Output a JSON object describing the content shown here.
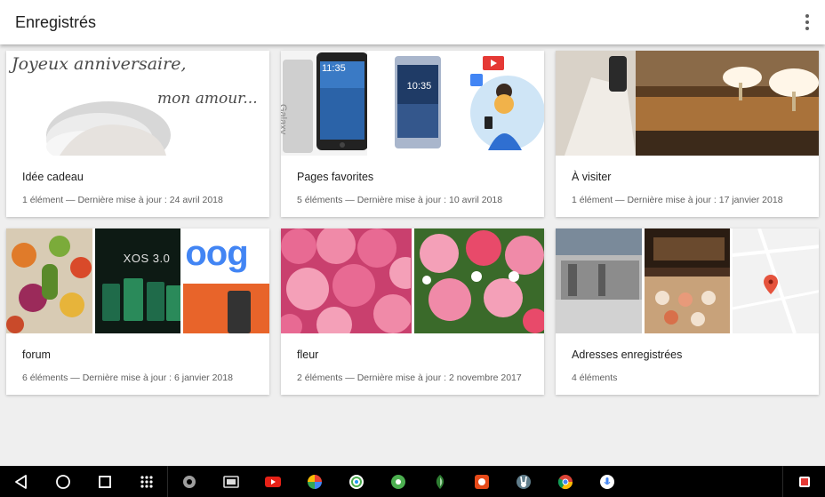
{
  "appbar": {
    "title": "Enregistrés",
    "menu_icon": "more-vert-icon"
  },
  "collections": [
    {
      "title": "Idée cadeau",
      "meta": "1 élément — Dernière mise à jour : 24 avril 2018",
      "thumb_text_1": "Joyeux anniversaire,",
      "thumb_text_2": "mon amour..."
    },
    {
      "title": "Pages favorites",
      "meta": "5 éléments — Dernière mise à jour : 10 avril 2018",
      "thumb_phone_time_1": "11:35",
      "thumb_phone_time_2": "10:35",
      "thumb_phone_brand": "Galaxy"
    },
    {
      "title": "À visiter",
      "meta": "1 élément — Dernière mise à jour : 17 janvier 2018"
    },
    {
      "title": "forum",
      "meta": "6 éléments — Dernière mise à jour : 6 janvier 2018",
      "thumb_xos": "XOS 3.0",
      "thumb_google": "oog"
    },
    {
      "title": "fleur",
      "meta": "2 éléments — Dernière mise à jour : 2 novembre 2017"
    },
    {
      "title": "Adresses enregistrées",
      "meta": "4 éléments"
    }
  ],
  "navbar": {
    "buttons": [
      "back-icon",
      "home-icon",
      "recents-icon",
      "app-drawer-icon"
    ],
    "apps": [
      "settings-icon",
      "tv-app-icon",
      "youtube-icon",
      "photos-icon",
      "quik-icon",
      "gear-app-icon",
      "snapseed-icon",
      "camera-app-icon",
      "rabbit-app-icon",
      "chrome-icon",
      "voice-search-icon",
      "stack-app-icon"
    ]
  },
  "colors": {
    "appbar_bg": "#ffffff",
    "page_bg": "#efefef",
    "navbar_bg": "#000000",
    "map_pin": "#e5533d"
  }
}
